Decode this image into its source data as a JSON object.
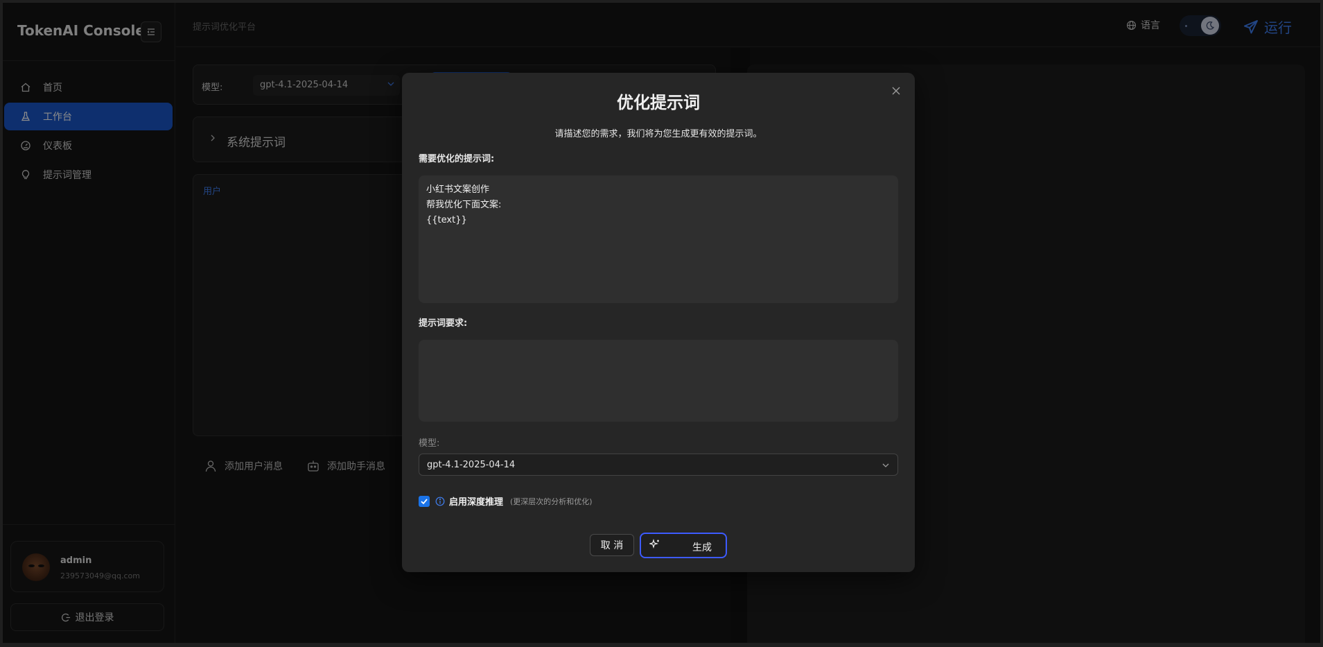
{
  "app": {
    "title": "TokenAI Console"
  },
  "sidebar": {
    "items": [
      {
        "label": "首页",
        "icon": "home-icon",
        "active": false
      },
      {
        "label": "工作台",
        "icon": "flask-icon",
        "active": true
      },
      {
        "label": "仪表板",
        "icon": "gauge-icon",
        "active": false
      },
      {
        "label": "提示词管理",
        "icon": "bulb-icon",
        "active": false
      }
    ],
    "user": {
      "name": "admin",
      "email": "239573049@qq.com"
    },
    "logout_label": "退出登录"
  },
  "header": {
    "breadcrumb": "提示词优化平台",
    "language_label": "语言",
    "run_label": "运行"
  },
  "main": {
    "model_label": "模型:",
    "model_value": "gpt-4.1-2025-04-14",
    "system_prompt_title": "系统提示词",
    "user_role_label": "用户",
    "add_user_message": "添加用户消息",
    "add_assistant_message": "添加助手消息"
  },
  "modal": {
    "title": "优化提示词",
    "subtitle": "请描述您的需求，我们将为您生成更有效的提示词。",
    "prompt_label": "需要优化的提示词:",
    "prompt_value": "小红书文案创作\n帮我优化下面文案:\n{{text}}",
    "requirements_label": "提示词要求:",
    "requirements_value": "",
    "model_label": "模型:",
    "model_value": "gpt-4.1-2025-04-14",
    "deep_reasoning_label": "启用深度推理",
    "deep_reasoning_hint": "(更深层次的分析和优化)",
    "deep_reasoning_checked": true,
    "cancel_label": "取 消",
    "generate_label": "生成"
  },
  "colors": {
    "accent": "#1a56c9",
    "link": "#3f7ef0",
    "generate_border": "#3d5bff"
  }
}
